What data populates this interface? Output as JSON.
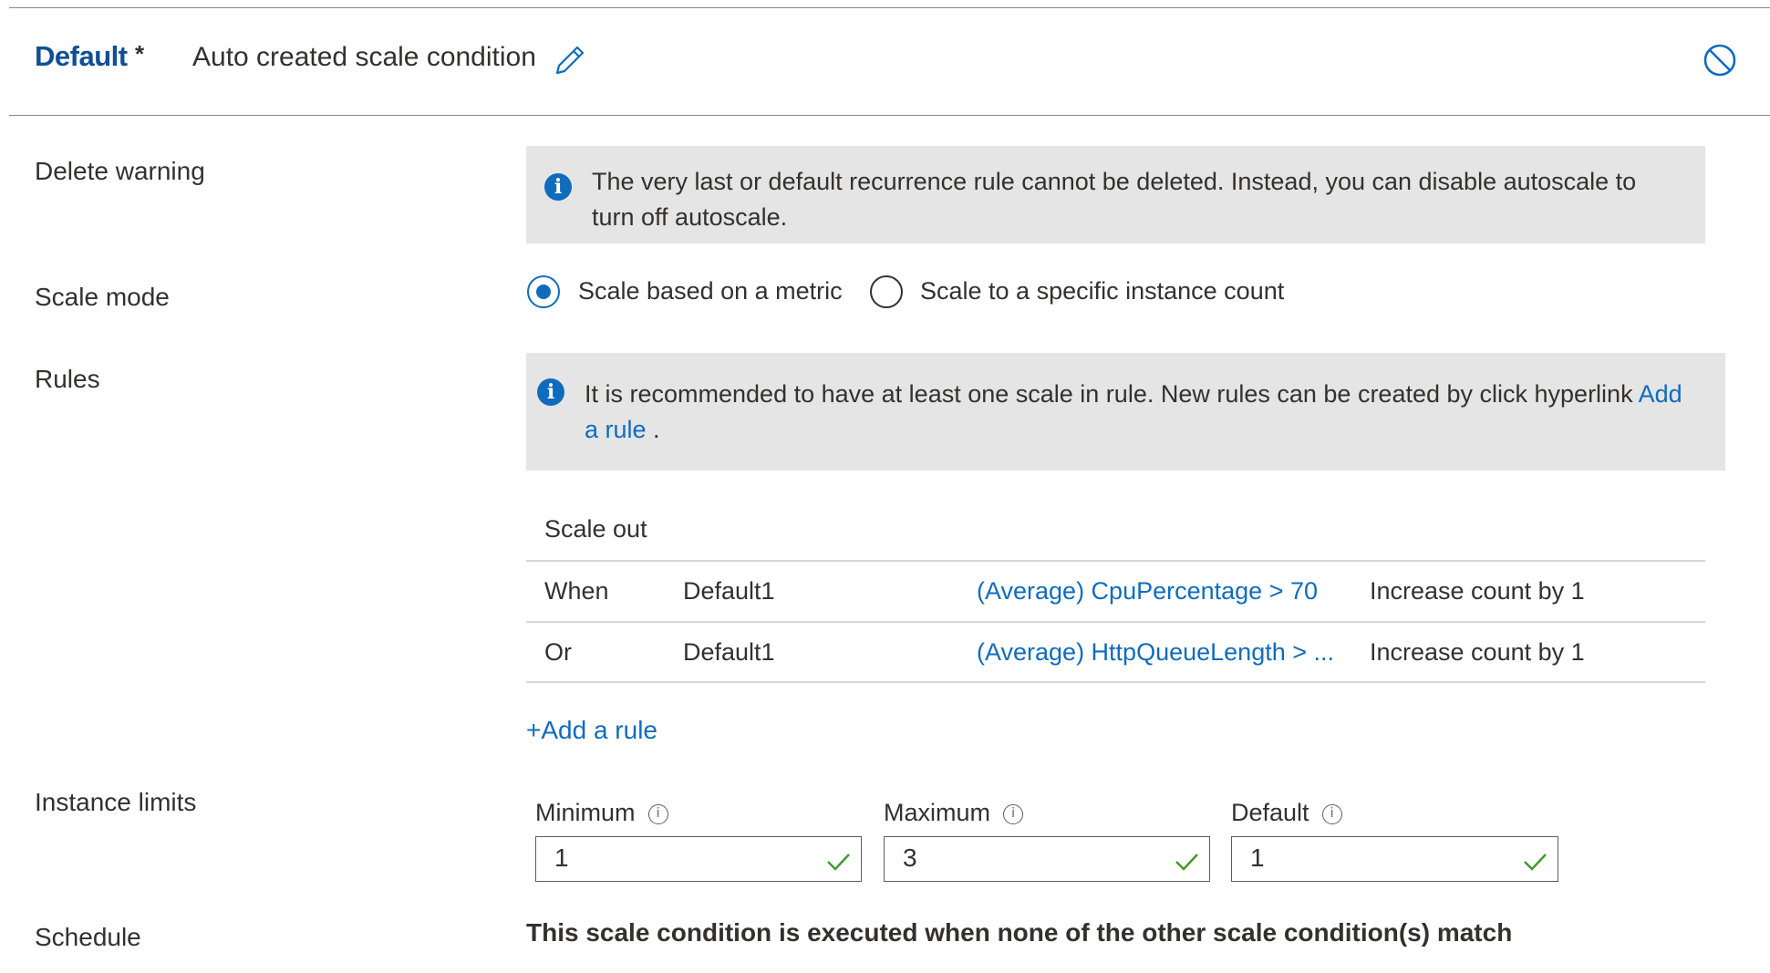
{
  "header": {
    "condition_name": "Default",
    "modified_marker": "*",
    "condition_title": "Auto created scale condition",
    "edit_icon": "pencil-icon",
    "disable_icon": "disable-circle-icon"
  },
  "delete_warning": {
    "label": "Delete warning",
    "line1": "The very last or default recurrence rule cannot be deleted. Instead, you can disable autoscale to",
    "line2": "turn off autoscale.",
    "icon": "info-icon"
  },
  "scale_mode": {
    "label": "Scale mode",
    "options": [
      {
        "label": "Scale based on a metric",
        "selected": true
      },
      {
        "label": "Scale to a specific instance count",
        "selected": false
      }
    ]
  },
  "rules": {
    "label": "Rules",
    "notice_line1": "It is recommended to have at least one scale in rule. New rules can be created by click hyperlink",
    "notice_link_part1": "Add",
    "notice_link_part2": "a rule",
    "notice_end": " .",
    "section_title": "Scale out",
    "rows": [
      {
        "condition": "When",
        "resource": "Default1",
        "metric": "(Average) CpuPercentage > 70",
        "action": "Increase count by 1"
      },
      {
        "condition": "Or",
        "resource": "Default1",
        "metric": "(Average) HttpQueueLength > ...",
        "action": "Increase count by 1"
      }
    ],
    "add_rule_plus": "+",
    "add_rule_label": "Add a rule"
  },
  "instance_limits": {
    "label": "Instance limits",
    "minimum": {
      "label": "Minimum",
      "value": "1"
    },
    "maximum": {
      "label": "Maximum",
      "value": "3"
    },
    "default": {
      "label": "Default",
      "value": "1"
    },
    "tooltip_glyph": "i"
  },
  "schedule": {
    "label": "Schedule",
    "text": "This scale condition is executed when none of the other scale condition(s) match"
  },
  "colors": {
    "accent": "#0f6cbd",
    "title": "#0f4f94",
    "info_bg": "#e5e5e5",
    "valid": "#3c9a2d"
  }
}
